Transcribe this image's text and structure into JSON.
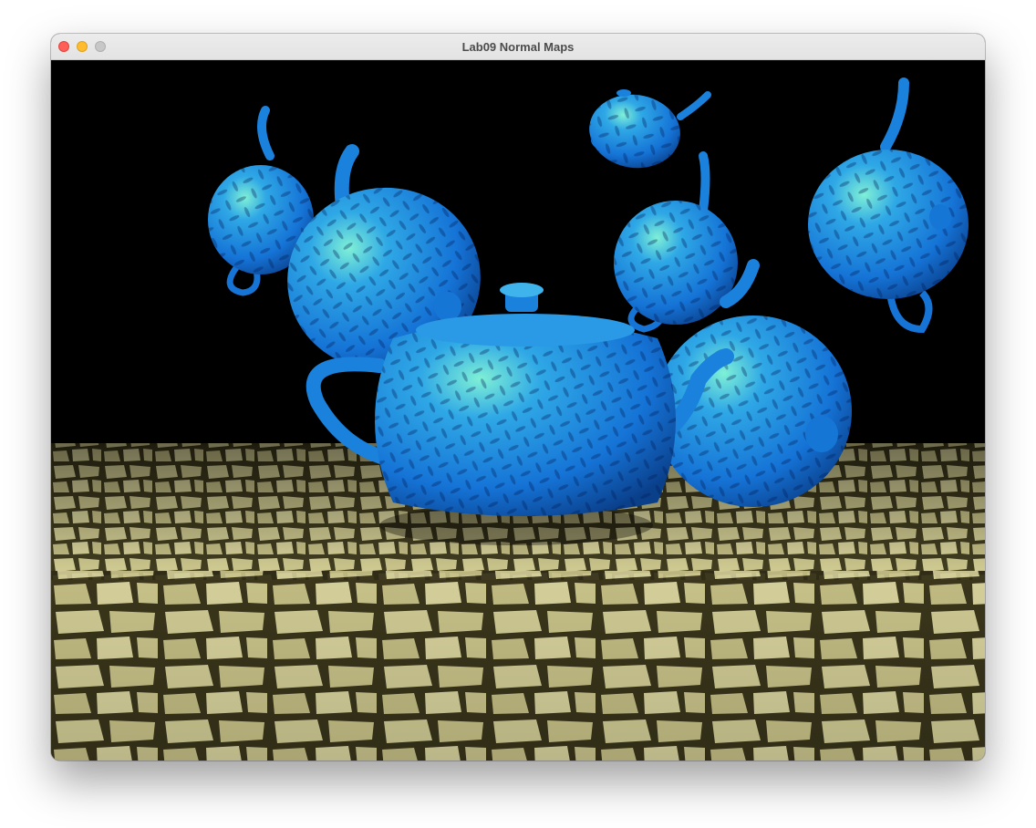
{
  "window": {
    "title": "Lab09 Normal Maps"
  },
  "scene": {
    "description_icons": [
      "teapot-icon",
      "cobblestone-floor"
    ],
    "colors": {
      "teapot": "#1a85e0",
      "teapot_highlight": "#5fe0c8",
      "floor_stone": "#d8d39a",
      "floor_grout": "#3a3418",
      "sky": "#000000"
    }
  }
}
